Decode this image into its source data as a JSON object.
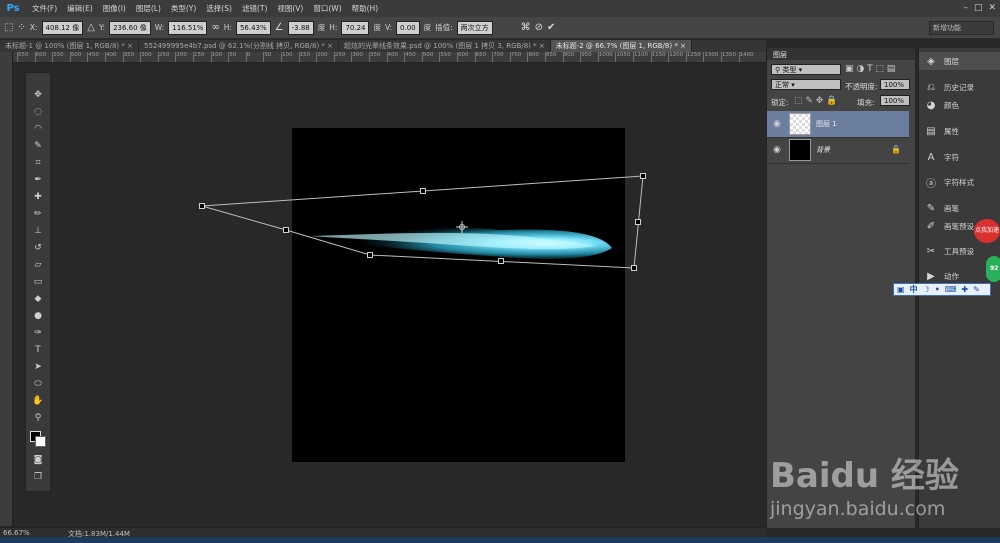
{
  "app": {
    "logo": "Ps"
  },
  "menu": [
    "文件(F)",
    "编辑(E)",
    "图像(I)",
    "图层(L)",
    "类型(Y)",
    "选择(S)",
    "滤镜(T)",
    "视图(V)",
    "窗口(W)",
    "帮助(H)"
  ],
  "window_controls": {
    "minimize": "–",
    "restore": "□",
    "close": "✕"
  },
  "options": {
    "x_label": "X:",
    "x_value": "408.12 像",
    "y_label": "Y:",
    "y_value": "236.60 像",
    "w_label": "W:",
    "w_value": "116.51%",
    "h_label": "H:",
    "h_value": "56.43%",
    "angle_value": "-3.88",
    "angle_unit": "度",
    "hskew_label": "H:",
    "hskew_value": "70.24",
    "hskew_unit": "度",
    "vskew_label": "V:",
    "vskew_value": "0.00",
    "vskew_unit": "度",
    "interp_label": "插值:",
    "interp_value": "两次立方",
    "workspace": "新增功能"
  },
  "tabs": [
    {
      "label": "未标题-1 @ 100% (图层 1, RGB/8) *",
      "active": false
    },
    {
      "label": "552499995e4b7.psd @ 62.1%(分割线 拷贝, RGB/8) *",
      "active": false
    },
    {
      "label": "超炫的光晕线条效果.psd @ 100% (图层 1 拷贝 3, RGB/8) *",
      "active": false
    },
    {
      "label": "未标题-2 @ 66.7% (图层 1, RGB/8) *",
      "active": true
    }
  ],
  "ruler_labels": [
    "650",
    "600",
    "550",
    "500",
    "450",
    "400",
    "350",
    "300",
    "250",
    "200",
    "150",
    "100",
    "50",
    "0",
    "50",
    "100",
    "150",
    "200",
    "250",
    "300",
    "350",
    "400",
    "450",
    "500",
    "550",
    "600",
    "650",
    "700",
    "750",
    "800",
    "850",
    "900",
    "950",
    "1000",
    "1050",
    "1100",
    "1150",
    "1200",
    "1250",
    "1300",
    "1350",
    "1400"
  ],
  "layers_panel": {
    "title": "图层",
    "kind": "类型",
    "blend_mode": "正常",
    "opacity_label": "不透明度:",
    "opacity_value": "100%",
    "lock_label": "锁定:",
    "fill_label": "填充:",
    "fill_value": "100%",
    "layers": [
      {
        "name": "图层 1",
        "selected": true
      },
      {
        "name": "背景",
        "selected": false
      }
    ]
  },
  "dock": [
    {
      "label": "图层",
      "icon": "layers-icon",
      "active": true
    },
    {
      "label": "历史记录",
      "icon": "history-icon",
      "active": false
    },
    {
      "label": "颜色",
      "icon": "color-icon",
      "active": false
    },
    {
      "label": "属性",
      "icon": "properties-icon",
      "active": false
    },
    {
      "label": "字符",
      "icon": "character-icon",
      "active": false
    },
    {
      "label": "字符样式",
      "icon": "character-style-icon",
      "active": false
    },
    {
      "label": "画笔",
      "icon": "brush-icon",
      "active": false
    },
    {
      "label": "画笔预设",
      "icon": "brush-preset-icon",
      "active": false
    },
    {
      "label": "工具预设",
      "icon": "tool-preset-icon",
      "active": false
    },
    {
      "label": "动作",
      "icon": "actions-icon",
      "active": false
    }
  ],
  "ime_bar": {
    "lang": "中"
  },
  "badge": {
    "text": "点我加速"
  },
  "frog": {
    "text": "92"
  },
  "status": {
    "zoom": "66.67%",
    "doc": "文档:1.83M/1.44M"
  },
  "watermark": {
    "main": "Baidu 经验",
    "sub": "jingyan.baidu.com"
  }
}
